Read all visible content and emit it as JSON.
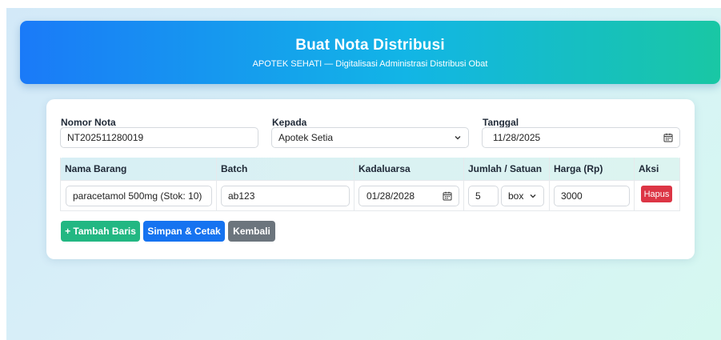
{
  "header": {
    "title": "Buat Nota Distribusi",
    "subtitle": "APOTEK SEHATI — Digitalisasi Administrasi Distribusi Obat"
  },
  "form": {
    "nomor_nota": {
      "label": "Nomor Nota",
      "value": "NT202511280019"
    },
    "kepada": {
      "label": "Kepada",
      "value": "Apotek Setia"
    },
    "tanggal": {
      "label": "Tanggal",
      "value": "11/28/2025"
    }
  },
  "table": {
    "headers": {
      "nama_barang": "Nama Barang",
      "batch": "Batch",
      "kadaluarsa": "Kadaluarsa",
      "jumlah_satuan": "Jumlah / Satuan",
      "harga": "Harga (Rp)",
      "aksi": "Aksi"
    },
    "rows": [
      {
        "nama_barang": "paracetamol 500mg (Stok: 10)",
        "batch": "ab123",
        "kadaluarsa": "01/28/2028",
        "jumlah": "5",
        "satuan": "box",
        "harga": "3000",
        "hapus_label": "Hapus"
      }
    ]
  },
  "actions": {
    "tambah_baris": "+ Tambah Baris",
    "simpan_cetak": "Simpan & Cetak",
    "kembali": "Kembali"
  },
  "icons": {
    "select_arrow": "chevron-down-icon",
    "date_picker": "calendar-icon"
  },
  "colors": {
    "header_gradient_start": "#1a7af8",
    "header_gradient_end": "#19c7a4",
    "button_add": "#22b782",
    "button_save": "#1673f0",
    "button_back": "#6c757d",
    "button_delete": "#dc3545"
  }
}
